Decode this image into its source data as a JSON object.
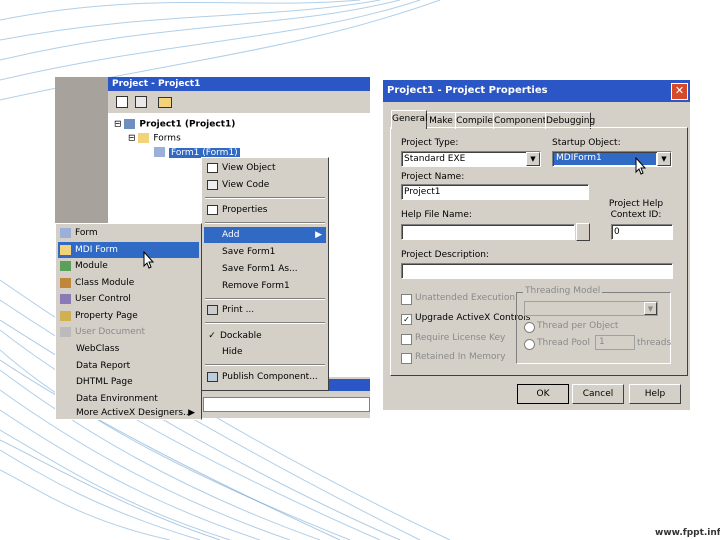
{
  "colors": {
    "accent": "#316ac5",
    "title_bar": "#2a56c6",
    "face": "#d4d0c8"
  },
  "project_explorer": {
    "title": "Project - Project1",
    "tree_root": "Project1 (Project1)",
    "tree_folder": "Forms",
    "tree_item": "Form1 (Form1)"
  },
  "context_menu": {
    "items": [
      "View Object",
      "View Code",
      "Properties",
      "Add",
      "Save Form1",
      "Save Form1 As...",
      "Remove Form1",
      "Print ...",
      "Dockable",
      "Hide",
      "Publish Component..."
    ]
  },
  "add_submenu": {
    "items": [
      "Form",
      "MDI Form",
      "Module",
      "Class Module",
      "User Control",
      "Property Page",
      "User Document",
      "WebClass",
      "Data Report",
      "DHTML Page",
      "Data Environment",
      "More ActiveX Designers..."
    ]
  },
  "dialog": {
    "title": "Project1 - Project Properties",
    "tabs": [
      "General",
      "Make",
      "Compile",
      "Component",
      "Debugging"
    ],
    "project_type_label": "Project Type:",
    "project_type_value": "Standard EXE",
    "startup_label": "Startup Object:",
    "startup_value": "MDIForm1",
    "project_name_label": "Project Name:",
    "project_name_value": "Project1",
    "help_file_label": "Help File Name:",
    "help_context_label": "Project Help Context ID:",
    "help_context_value": "0",
    "description_label": "Project Description:",
    "unattended_label": "Unattended Execution",
    "upgrade_label": "Upgrade ActiveX Controls",
    "license_label": "Require License Key",
    "retained_label": "Retained In Memory",
    "threading_label": "Threading Model",
    "thread_per_object_label": "Thread per Object",
    "thread_pool_label": "Thread Pool",
    "thread_pool_value": "1",
    "threads_label": "threads",
    "ok_label": "OK",
    "cancel_label": "Cancel",
    "help_label": "Help"
  },
  "footer": {
    "watermark": "www.fppt.info"
  }
}
